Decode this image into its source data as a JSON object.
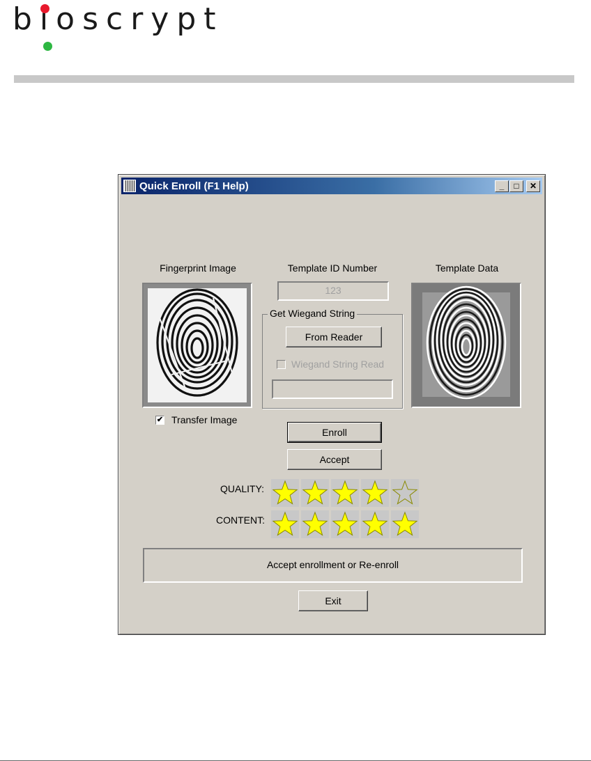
{
  "document": {
    "logo": "bioscrypt"
  },
  "window": {
    "title": "Quick Enroll (F1 Help)",
    "caption_buttons": {
      "minimize": "_",
      "maximize": "□",
      "close": "✕"
    }
  },
  "fingerprint_image": {
    "label": "Fingerprint Image"
  },
  "template_id": {
    "label": "Template ID Number",
    "value": "123"
  },
  "template_data": {
    "label": "Template Data"
  },
  "wiegand": {
    "group_title": "Get Wiegand String",
    "from_reader_label": "From Reader",
    "string_read_label": "Wiegand String Read",
    "string_read_checked": false,
    "value": ""
  },
  "transfer_image": {
    "label": "Transfer Image",
    "checked": true
  },
  "buttons": {
    "enroll": "Enroll",
    "accept": "Accept",
    "exit": "Exit"
  },
  "quality": {
    "label": "QUALITY:",
    "rating": 4,
    "max": 5
  },
  "content": {
    "label": "CONTENT:",
    "rating": 5,
    "max": 5
  },
  "status_message": "Accept enrollment or Re-enroll",
  "colors": {
    "title_bar": "#0a246a",
    "star_fill": "#ffff00",
    "star_empty": "#c8c8c8",
    "dialog_bg": "#d4d0c8"
  }
}
